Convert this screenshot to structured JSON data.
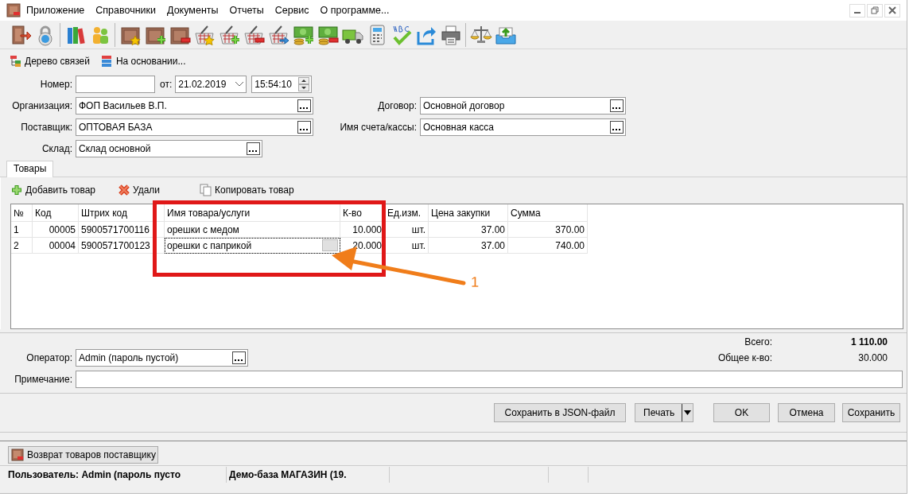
{
  "menu": [
    {
      "label": "Приложение"
    },
    {
      "label": "Справочники"
    },
    {
      "label": "Документы"
    },
    {
      "label": "Отчеты"
    },
    {
      "label": "Сервис"
    },
    {
      "label": "О программе..."
    }
  ],
  "links": [
    {
      "label": "Дерево связей",
      "kind": "tree"
    },
    {
      "label": "На основании...",
      "kind": "base"
    }
  ],
  "number": {
    "label": "Номер:"
  },
  "date": {
    "label": "от:",
    "value": "21.02.2019"
  },
  "time": {
    "value": "15:54:10"
  },
  "left_fields": [
    {
      "label": "Организация:",
      "value": "ФОП Васильев В.П."
    },
    {
      "label": "Поставщик:",
      "value": "ОПТОВАЯ БАЗА"
    },
    {
      "label": "Склад:",
      "value": "Склад основной"
    }
  ],
  "right_fields": [
    {
      "label": "Договор:",
      "value": "Основной договор"
    },
    {
      "label": "Имя счета/кассы:",
      "value": "Основная касса"
    }
  ],
  "tabs": [
    {
      "label": "Товары",
      "selected": true
    }
  ],
  "grid_toolbar": [
    {
      "label": "Добавить товар",
      "kind": "add"
    },
    {
      "label": "Удали",
      "kind": "delete"
    },
    {
      "label": "Копировать товар",
      "kind": "copy"
    }
  ],
  "table": {
    "columns": [
      "№",
      "Код",
      "Штрих код",
      "Имя товара/услуги",
      "К-во",
      "Ед.изм.",
      "Цена закупки",
      "Сумма"
    ],
    "rows": [
      {
        "cells": [
          "1",
          "00005",
          "5900571700116",
          "орешки с медом",
          "10.000",
          "шт.",
          "37.00",
          "370.00"
        ],
        "selected": false
      },
      {
        "cells": [
          "2",
          "00004",
          "5900571700123",
          "орешки с паприкой",
          "20.000",
          "шт.",
          "37.00",
          "740.00"
        ],
        "selected": true
      }
    ]
  },
  "totals": [
    {
      "label": "Всего:",
      "value": "1 110.00"
    },
    {
      "label": "Общее к-во:",
      "value": "30.000"
    }
  ],
  "operator": {
    "label": "Оператор:",
    "value": "Admin (пароль пустой)"
  },
  "note": {
    "label": "Примечание:"
  },
  "buttons": [
    {
      "label": "Сохранить в JSON-файл",
      "kind": "plain"
    },
    {
      "label": "Печать",
      "kind": "split"
    },
    {
      "label": "OK",
      "kind": "plain"
    },
    {
      "label": "Отмена",
      "kind": "plain"
    },
    {
      "label": "Сохранить",
      "kind": "plain"
    }
  ],
  "taskbar": [
    {
      "label": "Возврат товаров поставщику"
    }
  ],
  "status_bar": [
    "Пользователь: Admin (пароль пусто",
    "Демо-база МАГАЗИН (19."
  ],
  "annotation": {
    "label": "1"
  }
}
